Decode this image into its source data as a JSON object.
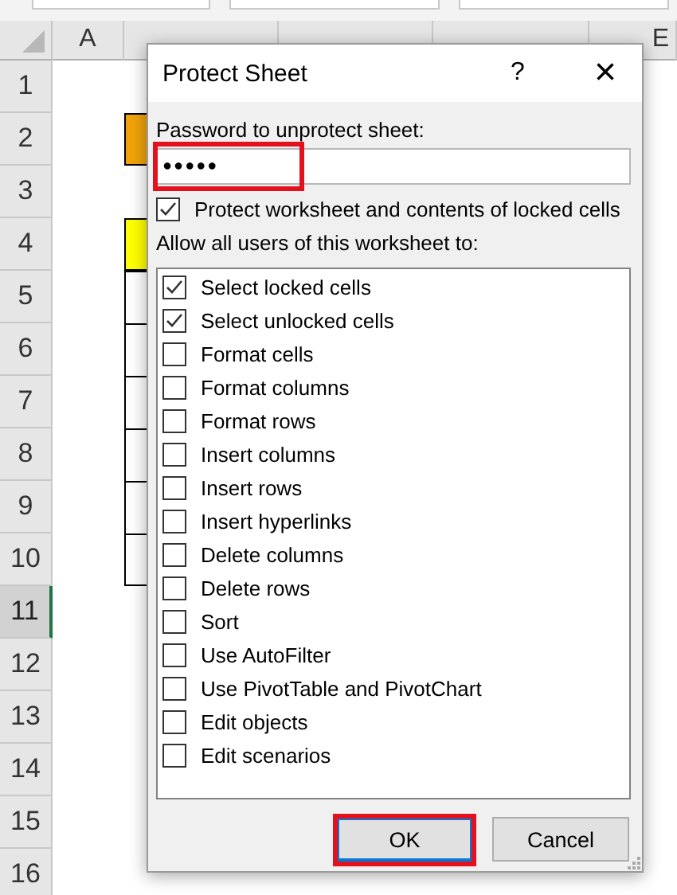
{
  "sheet": {
    "columns": [
      {
        "label": "A"
      },
      {},
      {},
      {},
      {
        "label": "E"
      }
    ],
    "rows": [
      {
        "label": "1",
        "selected": false
      },
      {
        "label": "2",
        "selected": false,
        "b_cell": {
          "kind": "filled",
          "color": "#f0a30a"
        }
      },
      {
        "label": "3",
        "selected": false
      },
      {
        "label": "4",
        "selected": false,
        "b_cell": {
          "kind": "filled",
          "color": "#ffff00"
        }
      },
      {
        "label": "5",
        "selected": false,
        "b_cell": {
          "kind": "bordered"
        }
      },
      {
        "label": "6",
        "selected": false,
        "b_cell": {
          "kind": "bordered"
        }
      },
      {
        "label": "7",
        "selected": false,
        "b_cell": {
          "kind": "bordered"
        }
      },
      {
        "label": "8",
        "selected": false,
        "b_cell": {
          "kind": "bordered"
        }
      },
      {
        "label": "9",
        "selected": false,
        "b_cell": {
          "kind": "bordered"
        }
      },
      {
        "label": "10",
        "selected": false,
        "b_cell": {
          "kind": "bordered"
        }
      },
      {
        "label": "11",
        "selected": true
      },
      {
        "label": "12",
        "selected": false
      },
      {
        "label": "13",
        "selected": false
      },
      {
        "label": "14",
        "selected": false
      },
      {
        "label": "15",
        "selected": false
      },
      {
        "label": "16",
        "selected": false
      }
    ]
  },
  "dialog": {
    "title": "Protect Sheet",
    "help": "?",
    "close": "×",
    "password": {
      "label": "Password to unprotect sheet:",
      "value": "●●●●●",
      "highlighted": true
    },
    "protect_option": {
      "label": "Protect worksheet and contents of locked cells",
      "checked": true
    },
    "permissions_label": "Allow all users of this worksheet to:",
    "permissions": [
      {
        "label": "Select locked cells",
        "checked": true
      },
      {
        "label": "Select unlocked cells",
        "checked": true
      },
      {
        "label": "Format cells",
        "checked": false
      },
      {
        "label": "Format columns",
        "checked": false
      },
      {
        "label": "Format rows",
        "checked": false
      },
      {
        "label": "Insert columns",
        "checked": false
      },
      {
        "label": "Insert rows",
        "checked": false
      },
      {
        "label": "Insert hyperlinks",
        "checked": false
      },
      {
        "label": "Delete columns",
        "checked": false
      },
      {
        "label": "Delete rows",
        "checked": false
      },
      {
        "label": "Sort",
        "checked": false
      },
      {
        "label": "Use AutoFilter",
        "checked": false
      },
      {
        "label": "Use PivotTable and PivotChart",
        "checked": false
      },
      {
        "label": "Edit objects",
        "checked": false
      },
      {
        "label": "Edit scenarios",
        "checked": false
      }
    ],
    "buttons": [
      {
        "label": "OK",
        "kind": "default",
        "highlighted": true
      },
      {
        "label": "Cancel",
        "kind": "normal",
        "highlighted": false
      }
    ]
  }
}
